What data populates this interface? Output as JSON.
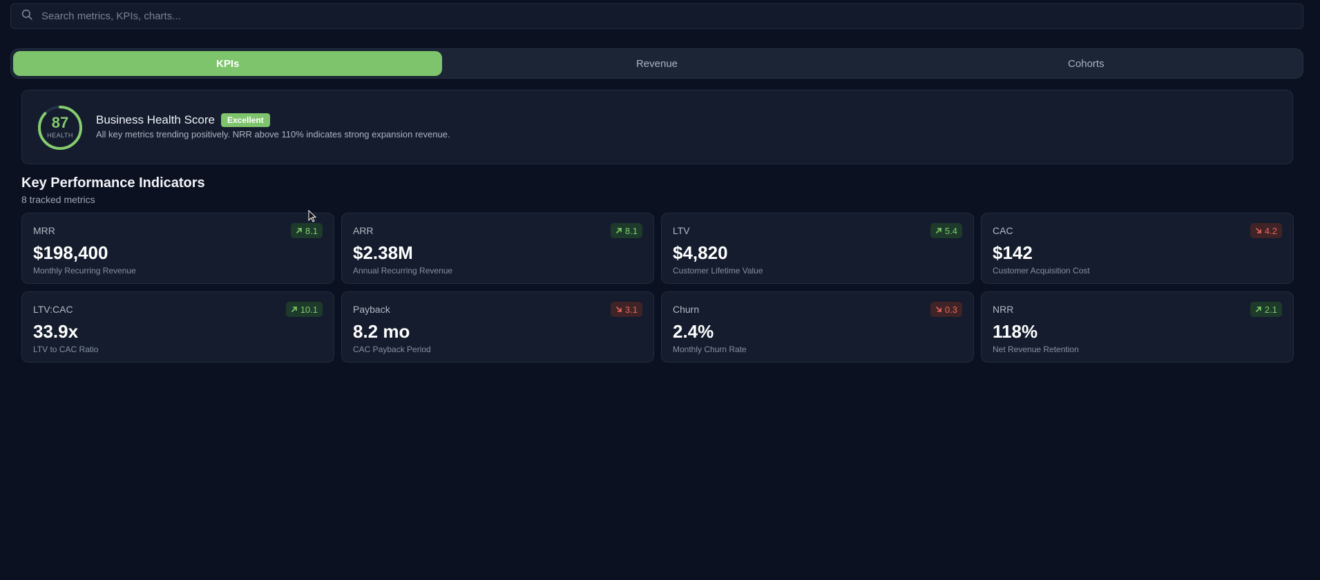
{
  "search": {
    "placeholder": "Search metrics, KPIs, charts..."
  },
  "tabs": [
    {
      "label": "KPIs",
      "active": true
    },
    {
      "label": "Revenue",
      "active": false
    },
    {
      "label": "Cohorts",
      "active": false
    }
  ],
  "health": {
    "score": "87",
    "score_fraction": 0.87,
    "score_label": "HEALTH",
    "title": "Business Health Score",
    "badge": "Excellent",
    "description": "All key metrics trending positively. NRR above 110% indicates strong expansion revenue."
  },
  "section": {
    "title": "Key Performance Indicators",
    "subtitle": "8 tracked metrics"
  },
  "kpis": [
    {
      "label": "MRR",
      "value": "$198,400",
      "desc": "Monthly Recurring Revenue",
      "delta": "8.1",
      "trend": "up"
    },
    {
      "label": "ARR",
      "value": "$2.38M",
      "desc": "Annual Recurring Revenue",
      "delta": "8.1",
      "trend": "up"
    },
    {
      "label": "LTV",
      "value": "$4,820",
      "desc": "Customer Lifetime Value",
      "delta": "5.4",
      "trend": "up"
    },
    {
      "label": "CAC",
      "value": "$142",
      "desc": "Customer Acquisition Cost",
      "delta": "4.2",
      "trend": "down"
    },
    {
      "label": "LTV:CAC",
      "value": "33.9x",
      "desc": "LTV to CAC Ratio",
      "delta": "10.1",
      "trend": "up"
    },
    {
      "label": "Payback",
      "value": "8.2 mo",
      "desc": "CAC Payback Period",
      "delta": "3.1",
      "trend": "down"
    },
    {
      "label": "Churn",
      "value": "2.4%",
      "desc": "Monthly Churn Rate",
      "delta": "0.3",
      "trend": "down"
    },
    {
      "label": "NRR",
      "value": "118%",
      "desc": "Net Revenue Retention",
      "delta": "2.1",
      "trend": "up"
    }
  ],
  "icons": {
    "search": "search-icon",
    "up": "arrow-up-right-icon",
    "down": "arrow-down-right-icon"
  },
  "colors": {
    "accent": "#7ec46c",
    "positive": "#7fcf6b",
    "negative": "#e8685c",
    "background": "#0b1120"
  }
}
